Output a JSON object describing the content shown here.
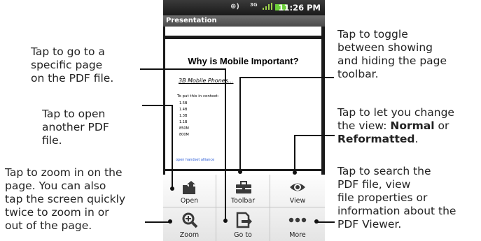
{
  "status_bar": {
    "time": "11:26 PM",
    "signal_label": "3G"
  },
  "app_title": "Presentation",
  "pdf_page": {
    "title": "Why is Mobile Important?",
    "subtitle": "3B Mobile Phones...",
    "context_label": "To put this in context:",
    "items": [
      "1.5B",
      "1.4B",
      "1.3B",
      "1.1B",
      "850M",
      "800M"
    ],
    "footer_link": "open handset alliance"
  },
  "menu": {
    "items": [
      {
        "label": "Open",
        "icon": "open-folder-icon"
      },
      {
        "label": "Toolbar",
        "icon": "toolbox-icon"
      },
      {
        "label": "View",
        "icon": "eye-icon"
      },
      {
        "label": "Zoom",
        "icon": "magnifier-plus-icon"
      },
      {
        "label": "Go to",
        "icon": "goto-page-icon"
      },
      {
        "label": "More",
        "icon": "more-dots-icon"
      }
    ]
  },
  "annotations": {
    "goto": [
      "Tap to go to a",
      "specific page",
      "on the PDF file."
    ],
    "open": [
      "Tap to open",
      "another PDF",
      "file."
    ],
    "zoom": [
      "Tap to zoom in on the",
      "page. You can also",
      "tap the screen quickly",
      "twice to zoom in or",
      "out of the page."
    ],
    "toolbar": [
      "Tap to toggle",
      "between showing",
      "and hiding the page",
      "toolbar."
    ],
    "view": {
      "line1": "Tap to let you change",
      "line2_prefix": "the view: ",
      "normal": "Normal",
      "line2_suffix": " or",
      "reformatted": "Reformatted",
      "end": "."
    },
    "more": [
      "Tap to search the",
      "PDF file, view",
      "file properties or",
      "information about the",
      "PDF Viewer."
    ]
  }
}
